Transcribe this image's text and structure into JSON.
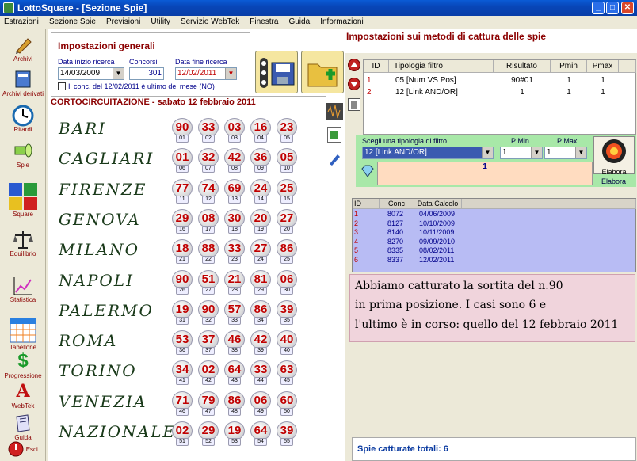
{
  "window": {
    "title": "LottoSquare - [Sezione Spie]"
  },
  "menu": [
    "Estrazioni",
    "Sezione Spie",
    "Previsioni",
    "Utility",
    "Servizio WebTek",
    "Finestra",
    "Guida",
    "Informazioni"
  ],
  "sidebar": [
    "Archivi",
    "Archivi derivati",
    "Ritardi",
    "Spie",
    "Square",
    "Equilibrio",
    "Statistica",
    "Tabellone",
    "Progressione",
    "WebTek",
    "Guida",
    "Esci"
  ],
  "settings": {
    "title": "Impostazioni generali",
    "start_label": "Data inizio ricerca",
    "start_value": "14/03/2009",
    "concorsi_label": "Concorsi",
    "concorsi_value": "301",
    "end_label": "Data fine ricerca",
    "end_value": "12/02/2011",
    "check_label": "Il conc. del 12/02/2011 è ultimo del mese (NO)"
  },
  "draw_title": "CORTOCIRCUITAZIONE - sabato 12 febbraio 2011",
  "wheels": [
    {
      "city": "BARI",
      "nums": [
        "90",
        "33",
        "03",
        "16",
        "23"
      ],
      "pos": [
        "01",
        "02",
        "03",
        "04",
        "05"
      ]
    },
    {
      "city": "CAGLIARI",
      "nums": [
        "01",
        "32",
        "42",
        "36",
        "05"
      ],
      "pos": [
        "06",
        "07",
        "08",
        "09",
        "10"
      ]
    },
    {
      "city": "FIRENZE",
      "nums": [
        "77",
        "74",
        "69",
        "24",
        "25"
      ],
      "pos": [
        "11",
        "12",
        "13",
        "14",
        "15"
      ]
    },
    {
      "city": "GENOVA",
      "nums": [
        "29",
        "08",
        "30",
        "20",
        "27"
      ],
      "pos": [
        "16",
        "17",
        "18",
        "19",
        "20"
      ]
    },
    {
      "city": "MILANO",
      "nums": [
        "18",
        "88",
        "33",
        "27",
        "86"
      ],
      "pos": [
        "21",
        "22",
        "23",
        "24",
        "25"
      ]
    },
    {
      "city": "NAPOLI",
      "nums": [
        "90",
        "51",
        "21",
        "81",
        "06"
      ],
      "pos": [
        "26",
        "27",
        "28",
        "29",
        "30"
      ]
    },
    {
      "city": "PALERMO",
      "nums": [
        "19",
        "90",
        "57",
        "86",
        "39"
      ],
      "pos": [
        "31",
        "32",
        "33",
        "34",
        "35"
      ]
    },
    {
      "city": "ROMA",
      "nums": [
        "53",
        "37",
        "46",
        "42",
        "40"
      ],
      "pos": [
        "36",
        "37",
        "38",
        "39",
        "40"
      ]
    },
    {
      "city": "TORINO",
      "nums": [
        "34",
        "02",
        "64",
        "33",
        "63"
      ],
      "pos": [
        "41",
        "42",
        "43",
        "44",
        "45"
      ]
    },
    {
      "city": "VENEZIA",
      "nums": [
        "71",
        "79",
        "86",
        "06",
        "60"
      ],
      "pos": [
        "46",
        "47",
        "48",
        "49",
        "50"
      ]
    },
    {
      "city": "NAZIONALE",
      "nums": [
        "02",
        "29",
        "19",
        "64",
        "39"
      ],
      "pos": [
        "51",
        "52",
        "53",
        "54",
        "55"
      ]
    }
  ],
  "methods": {
    "title": "Impostazioni sui metodi di cattura delle spie",
    "headers": [
      "ID",
      "Tipologia filtro",
      "Risultato",
      "Pmin",
      "Pmax"
    ],
    "rows": [
      {
        "id": "1",
        "tipo": "05 [Num VS Pos]",
        "ris": "90#01",
        "pmin": "1",
        "pmax": "1"
      },
      {
        "id": "2",
        "tipo": "12 [Link AND/OR]",
        "ris": "1",
        "pmin": "1",
        "pmax": "1"
      }
    ]
  },
  "filter": {
    "choose_label": "Scegli una tipologia di filtro",
    "pmin_label": "P Min",
    "pmax_label": "P Max",
    "selected": "12 [Link AND/OR]",
    "pmin": "1",
    "pmax": "1",
    "value": "1",
    "elabora": "Elabora",
    "elabora2": "Elabora"
  },
  "results": {
    "headers": [
      "ID",
      "Conc",
      "Data Calcolo"
    ],
    "rows": [
      {
        "id": "1",
        "conc": "8072",
        "data": "04/06/2009"
      },
      {
        "id": "2",
        "conc": "8127",
        "data": "10/10/2009"
      },
      {
        "id": "3",
        "conc": "8140",
        "data": "10/11/2009"
      },
      {
        "id": "4",
        "conc": "8270",
        "data": "09/09/2010"
      },
      {
        "id": "5",
        "conc": "8335",
        "data": "08/02/2011"
      },
      {
        "id": "6",
        "conc": "8337",
        "data": "12/02/2011"
      }
    ]
  },
  "note": [
    "Abbiamo catturato la sortita del n.90",
    "in prima posizione. I casi sono 6 e",
    "l'ultimo è in corso: quello del 12 febbraio 2011"
  ],
  "footer": "Spie catturate totali: 6"
}
